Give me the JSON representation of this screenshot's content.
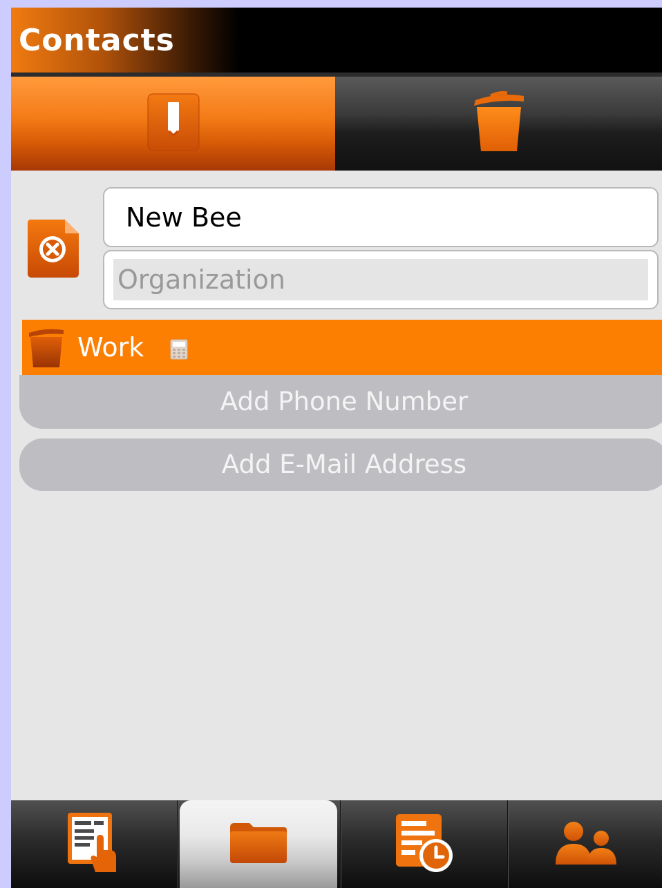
{
  "app": {
    "title": "Contacts"
  },
  "toolbar": {
    "edit_icon": "edit-pencil-icon",
    "delete_icon": "trash-icon"
  },
  "contact": {
    "icon": "contact-card-remove-icon",
    "name": "New Bee",
    "organization_placeholder": "Organization"
  },
  "phone": {
    "label": "Work",
    "type_icon": "phone-icon",
    "delete_icon": "trash-icon"
  },
  "actions": {
    "add_phone": "Add Phone Number",
    "add_email": "Add E-Mail Address"
  },
  "bottom_nav": [
    {
      "icon": "details-touch-icon"
    },
    {
      "icon": "folder-icon",
      "selected": true
    },
    {
      "icon": "history-clock-icon"
    },
    {
      "icon": "contacts-people-icon"
    }
  ],
  "colors": {
    "accent": "#fd7f02",
    "accent_dark": "#c44d05",
    "background": "#e6e6e6",
    "frame": "#ccccff"
  }
}
